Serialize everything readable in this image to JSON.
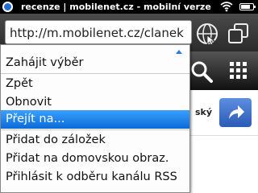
{
  "status_bar": {
    "title": "recenze | mobilenet.cz - mobilní verze",
    "app_icon": "browser-globe-icon",
    "wifi_icon": "wifi-icon",
    "battery_icon": "battery-icon"
  },
  "address_bar": {
    "url": "http://m.mobilenet.cz/clanek"
  },
  "toolbar_icons": {
    "globe": "globe-icon",
    "tabs": "tabs-icon"
  },
  "page": {
    "fragment_text": "ský",
    "search_icon": "search-icon",
    "grid_icon": "grid-icon",
    "share_icon": "share-arrow-icon"
  },
  "menu": {
    "header_item": "Zahájit výběr",
    "group1": [
      "Zpět",
      "Obnovit",
      "Přejít na..."
    ],
    "selected": "Přejít na...",
    "group2": [
      "Přidat do záložek",
      "Přidat na domovskou obraz.",
      "Přihlásit k odběru kanálu RSS"
    ]
  },
  "colors": {
    "selection": "#1a80f0",
    "share_button": "#3d72cf"
  }
}
